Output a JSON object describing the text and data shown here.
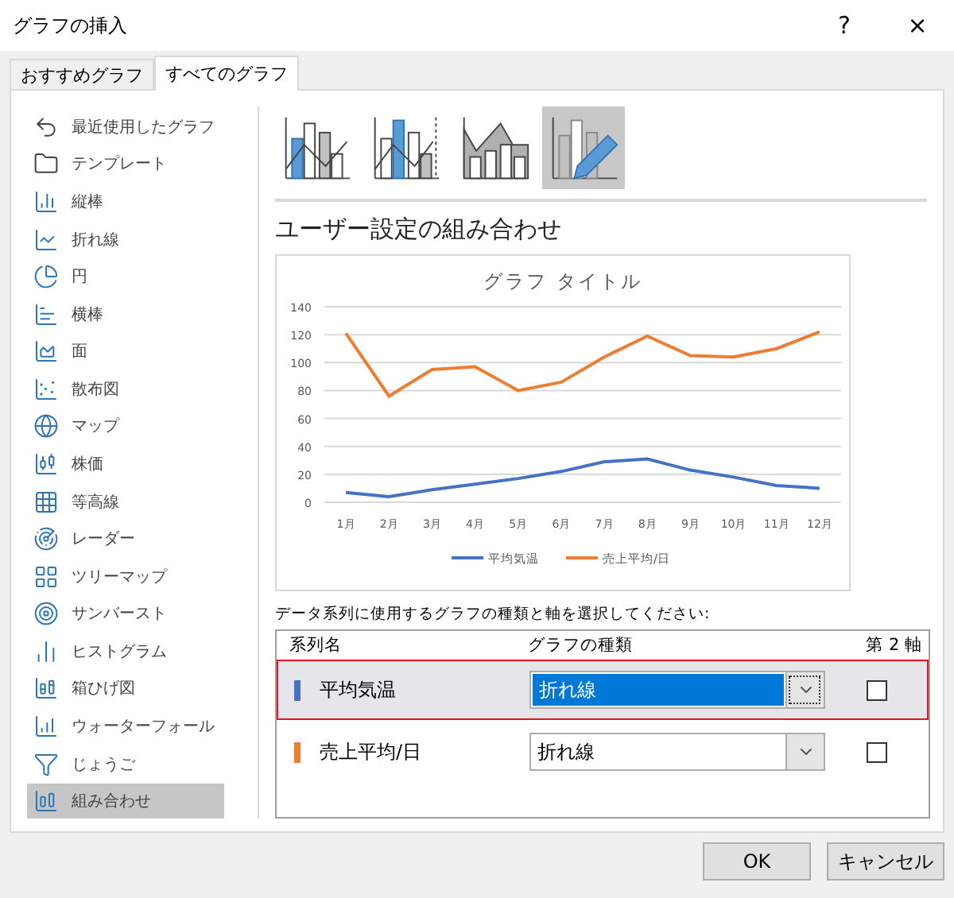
{
  "window": {
    "title": "グラフの挿入",
    "help": "?",
    "close": "×"
  },
  "tabs": [
    {
      "label": "おすすめグラフ",
      "selected": false
    },
    {
      "label": "すべてのグラフ",
      "selected": true
    }
  ],
  "sidebar": {
    "items": [
      {
        "label": "最近使用したグラフ",
        "selected": false
      },
      {
        "label": "テンプレート",
        "selected": false
      },
      {
        "label": "縦棒",
        "selected": false
      },
      {
        "label": "折れ線",
        "selected": false
      },
      {
        "label": "円",
        "selected": false
      },
      {
        "label": "横棒",
        "selected": false
      },
      {
        "label": "面",
        "selected": false
      },
      {
        "label": "散布図",
        "selected": false
      },
      {
        "label": "マップ",
        "selected": false
      },
      {
        "label": "株価",
        "selected": false
      },
      {
        "label": "等高線",
        "selected": false
      },
      {
        "label": "レーダー",
        "selected": false
      },
      {
        "label": "ツリーマップ",
        "selected": false
      },
      {
        "label": "サンバースト",
        "selected": false
      },
      {
        "label": "ヒストグラム",
        "selected": false
      },
      {
        "label": "箱ひげ図",
        "selected": false
      },
      {
        "label": "ウォーターフォール",
        "selected": false
      },
      {
        "label": "じょうご",
        "selected": false
      },
      {
        "label": "組み合わせ",
        "selected": true
      }
    ]
  },
  "subtypes": [
    {
      "kind": "clustered",
      "selected": false
    },
    {
      "kind": "secondary",
      "selected": false
    },
    {
      "kind": "area",
      "selected": false
    },
    {
      "kind": "custom",
      "selected": true
    }
  ],
  "heading": "ユーザー設定の組み合わせ",
  "preview": {
    "chart_data": {
      "type": "line",
      "title": "グラフ タイトル",
      "categories": [
        "1月",
        "2月",
        "3月",
        "4月",
        "5月",
        "6月",
        "7月",
        "8月",
        "9月",
        "10月",
        "11月",
        "12月"
      ],
      "series": [
        {
          "name": "平均気温",
          "color": "#4472c4",
          "values": [
            7,
            4,
            9,
            13,
            17,
            22,
            29,
            31,
            23,
            18,
            12,
            10
          ]
        },
        {
          "name": "売上平均/日",
          "color": "#ed7d31",
          "values": [
            121,
            76,
            95,
            97,
            80,
            86,
            104,
            119,
            105,
            104,
            110,
            122
          ]
        }
      ],
      "ylim": [
        0,
        140
      ],
      "grid": true,
      "legend": "bottom",
      "yticks": [
        0,
        20,
        40,
        60,
        80,
        100,
        120,
        140
      ]
    }
  },
  "series_prompt": "データ系列に使用するグラフの種類と軸を選択してください:",
  "series_table": {
    "columns": [
      "系列名",
      "グラフの種類",
      "第 2 軸"
    ],
    "rows": [
      {
        "name": "平均気温",
        "color": "#4472c4",
        "chart_type": "折れ線",
        "secondary_axis": false,
        "selected": true
      },
      {
        "name": "売上平均/日",
        "color": "#ed7d31",
        "chart_type": "折れ線",
        "secondary_axis": false,
        "selected": false
      }
    ]
  },
  "buttons": [
    {
      "label": "OK"
    },
    {
      "label": "キャンセル"
    }
  ]
}
